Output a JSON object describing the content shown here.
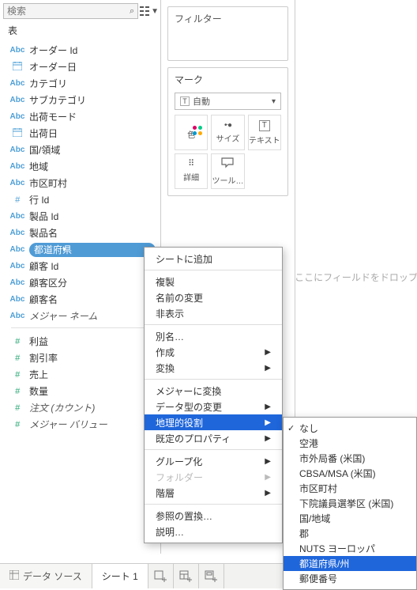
{
  "search": {
    "placeholder": "検索"
  },
  "section_header": "表",
  "dim_fields": [
    {
      "icon": "Abc",
      "iconClass": "icon-str",
      "label": "オーダー Id"
    },
    {
      "icon": "📅",
      "iconClass": "icon-date",
      "label": "オーダー日"
    },
    {
      "icon": "Abc",
      "iconClass": "icon-str",
      "label": "カテゴリ"
    },
    {
      "icon": "Abc",
      "iconClass": "icon-str",
      "label": "サブカテゴリ"
    },
    {
      "icon": "Abc",
      "iconClass": "icon-str",
      "label": "出荷モード"
    },
    {
      "icon": "📅",
      "iconClass": "icon-date",
      "label": "出荷日"
    },
    {
      "icon": "Abc",
      "iconClass": "icon-str",
      "label": "国/領域"
    },
    {
      "icon": "Abc",
      "iconClass": "icon-str",
      "label": "地域"
    },
    {
      "icon": "Abc",
      "iconClass": "icon-str",
      "label": "市区町村"
    },
    {
      "icon": "#",
      "iconClass": "icon-num-blue",
      "label": "行 Id"
    },
    {
      "icon": "Abc",
      "iconClass": "icon-str",
      "label": "製品 Id"
    },
    {
      "icon": "Abc",
      "iconClass": "icon-str",
      "label": "製品名"
    },
    {
      "icon": "Abc",
      "iconClass": "icon-str",
      "label": "都道府県",
      "pill": true
    },
    {
      "icon": "Abc",
      "iconClass": "icon-str",
      "label": "顧客 Id"
    },
    {
      "icon": "Abc",
      "iconClass": "icon-str",
      "label": "顧客区分"
    },
    {
      "icon": "Abc",
      "iconClass": "icon-str",
      "label": "顧客名"
    },
    {
      "icon": "Abc",
      "iconClass": "icon-str",
      "label": "メジャー ネーム",
      "italic": true
    }
  ],
  "measure_fields": [
    {
      "icon": "#",
      "iconClass": "icon-num-green",
      "label": "利益"
    },
    {
      "icon": "#",
      "iconClass": "icon-num-green",
      "label": "割引率"
    },
    {
      "icon": "#",
      "iconClass": "icon-num-green",
      "label": "売上"
    },
    {
      "icon": "#",
      "iconClass": "icon-num-green",
      "label": "数量"
    },
    {
      "icon": "#",
      "iconClass": "icon-num-green",
      "label": "注文 (カウント)",
      "italic": true
    },
    {
      "icon": "#",
      "iconClass": "icon-num-green",
      "label": "メジャー バリュー",
      "italic": true
    }
  ],
  "shelves": {
    "filters": "フィルター"
  },
  "marks": {
    "title": "マーク",
    "type_label": "自動",
    "cells": {
      "color": "色",
      "size": "サイズ",
      "text": "テキスト",
      "detail": "詳細",
      "tooltip": "ツール…"
    }
  },
  "canvas_hint": "ここにフィールドをドロップ",
  "bottom": {
    "data_source": "データ ソース",
    "sheet1": "シート 1"
  },
  "ctx": {
    "add_to_sheet": "シートに追加",
    "duplicate": "複製",
    "rename": "名前の変更",
    "hide": "非表示",
    "aliases": "別名…",
    "create": "作成",
    "transform": "変換",
    "to_measure": "メジャーに変換",
    "change_type": "データ型の変更",
    "geo_role": "地理的役割",
    "default_props": "既定のプロパティ",
    "group_by": "グループ化",
    "folder": "フォルダー",
    "hierarchy": "階層",
    "replace_ref": "参照の置換…",
    "describe": "説明…"
  },
  "geo": {
    "none": "なし",
    "airport": "空港",
    "area_code": "市外局番 (米国)",
    "cbsa": "CBSA/MSA (米国)",
    "city": "市区町村",
    "congress": "下院議員選挙区 (米国)",
    "country": "国/地域",
    "county": "郡",
    "nuts": "NUTS ヨーロッパ",
    "state": "都道府県/州",
    "zip": "郵便番号"
  }
}
